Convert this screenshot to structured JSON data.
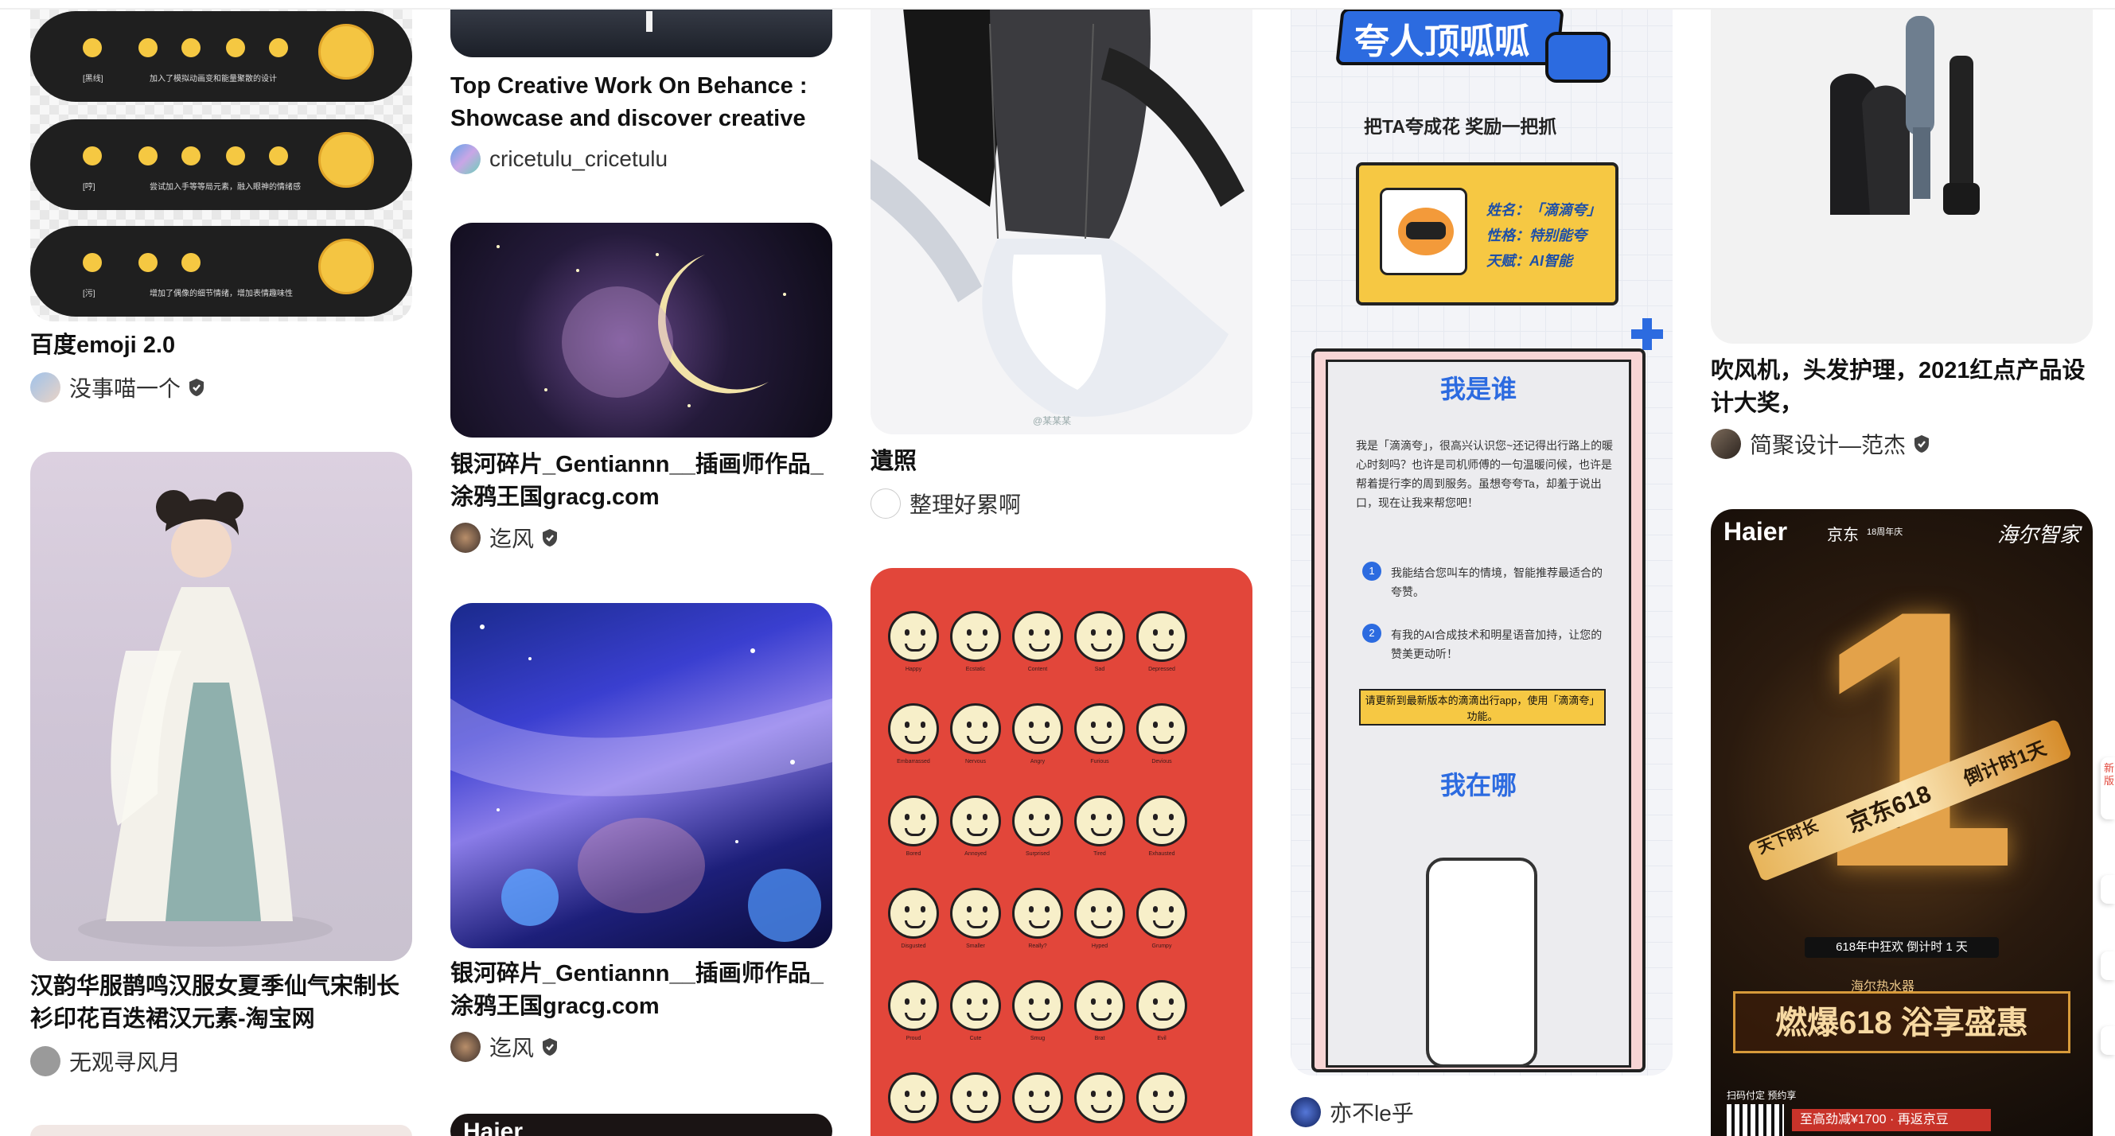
{
  "pins": {
    "c1": {
      "emoji": {
        "title": "百度emoji 2.0",
        "author": "没事喵一个",
        "rows": [
          {
            "tag": "[黑线]",
            "desc": "加入了模拟动画变和能量聚散的设计"
          },
          {
            "tag": "[哼]",
            "desc": "尝试加入手等等局元素，融入眼神的情绪感"
          },
          {
            "tag": "[污]",
            "desc": "增加了偶像的细节情绪，增加表情趣味性"
          }
        ]
      },
      "hanfu": {
        "title": "汉韵华服鹊鸣汉服女夏季仙气宋制长衫印花百迭裙汉元素-淘宝网",
        "author": "无观寻风月"
      }
    },
    "c2": {
      "behance": {
        "title": "Top Creative Work On Behance : Showcase and discover creative wor...",
        "author": "cricetulu_cricetulu"
      },
      "galaxy1": {
        "title": "银河碎片_Gentiannn__插画师作品_涂鸦王国gracg.com",
        "author": "迄风"
      },
      "galaxy2": {
        "title": "银河碎片_Gentiannn__插画师作品_涂鸦王国gracg.com",
        "author": "迄风"
      },
      "haier_peek": {
        "brand": "Haier"
      }
    },
    "c3": {
      "portrait": {
        "title": "遺照",
        "author": "整理好累啊",
        "watermark": "@某某某"
      },
      "emoticons": {
        "labels": [
          [
            "Happy",
            "Ecstatic",
            "Content",
            "Sad",
            "Depressed"
          ],
          [
            "Embarrassed",
            "Nervous",
            "Angry",
            "Furious",
            "Devious"
          ],
          [
            "Bored",
            "Annoyed",
            "Surprised",
            "Tired",
            "Exhausted"
          ],
          [
            "Disgusted",
            "Smaller",
            "Really?",
            "Hyped",
            "Grumpy"
          ],
          [
            "Proud",
            "Cute",
            "Smug",
            "Brat",
            "Evil"
          ]
        ]
      }
    },
    "c4": {
      "didi": {
        "banner": "夸人顶呱呱",
        "subtitle": "把TA夸成花 奖励一把抓",
        "name": "姓名：「滴滴夸」",
        "personality": "性格：特别能夸",
        "talent": "天赋：AI智能",
        "section1": "我是谁",
        "intro": "我是「滴滴夸」，很高兴认识您~还记得出行路上的暖心时刻吗？也许是司机师傅的一句温暖问候，也许是帮着提行李的周到服务。虽想夸夸Ta，却羞于说出口，现在让我来帮您吧！",
        "point1_num": "1",
        "point1": "我能结合您叫车的情境，智能推荐最适合的夸赞。",
        "point2_num": "2",
        "point2": "有我的AI合成技术和明星语音加持，让您的赞美更动听！",
        "update": "请更新到最新版本的滴滴出行app，使用「滴滴夸」功能。",
        "section2": "我在哪",
        "author": "亦不le乎"
      }
    },
    "c5": {
      "dryer": {
        "title": "吹风机，头发护理，2021红点产品设计大奖，",
        "author": "简聚设计—范杰"
      },
      "haier": {
        "brand": "Haier",
        "partner": "京东",
        "anniversary": "18周年庆",
        "signature": "海尔智家",
        "big_number": "1",
        "ribbon1": "天下时长",
        "ribbon2": "京东618",
        "ribbon3": "倒计时1天",
        "countdown": "618年中狂欢 倒计时 1 天",
        "product": "海尔热水器",
        "headline": "燃爆618 浴享盛惠",
        "scan": "扫码付定 预约享",
        "promo": "至高劲减¥1700 · 再返京豆"
      }
    },
    "edge": {
      "label": "新版"
    }
  },
  "colors": {
    "accent_red": "#e2463a",
    "verified_gray": "#444444",
    "didi_blue": "#2c6be0",
    "didi_yellow": "#f6c843",
    "haier_gold": "#d79a3a"
  }
}
